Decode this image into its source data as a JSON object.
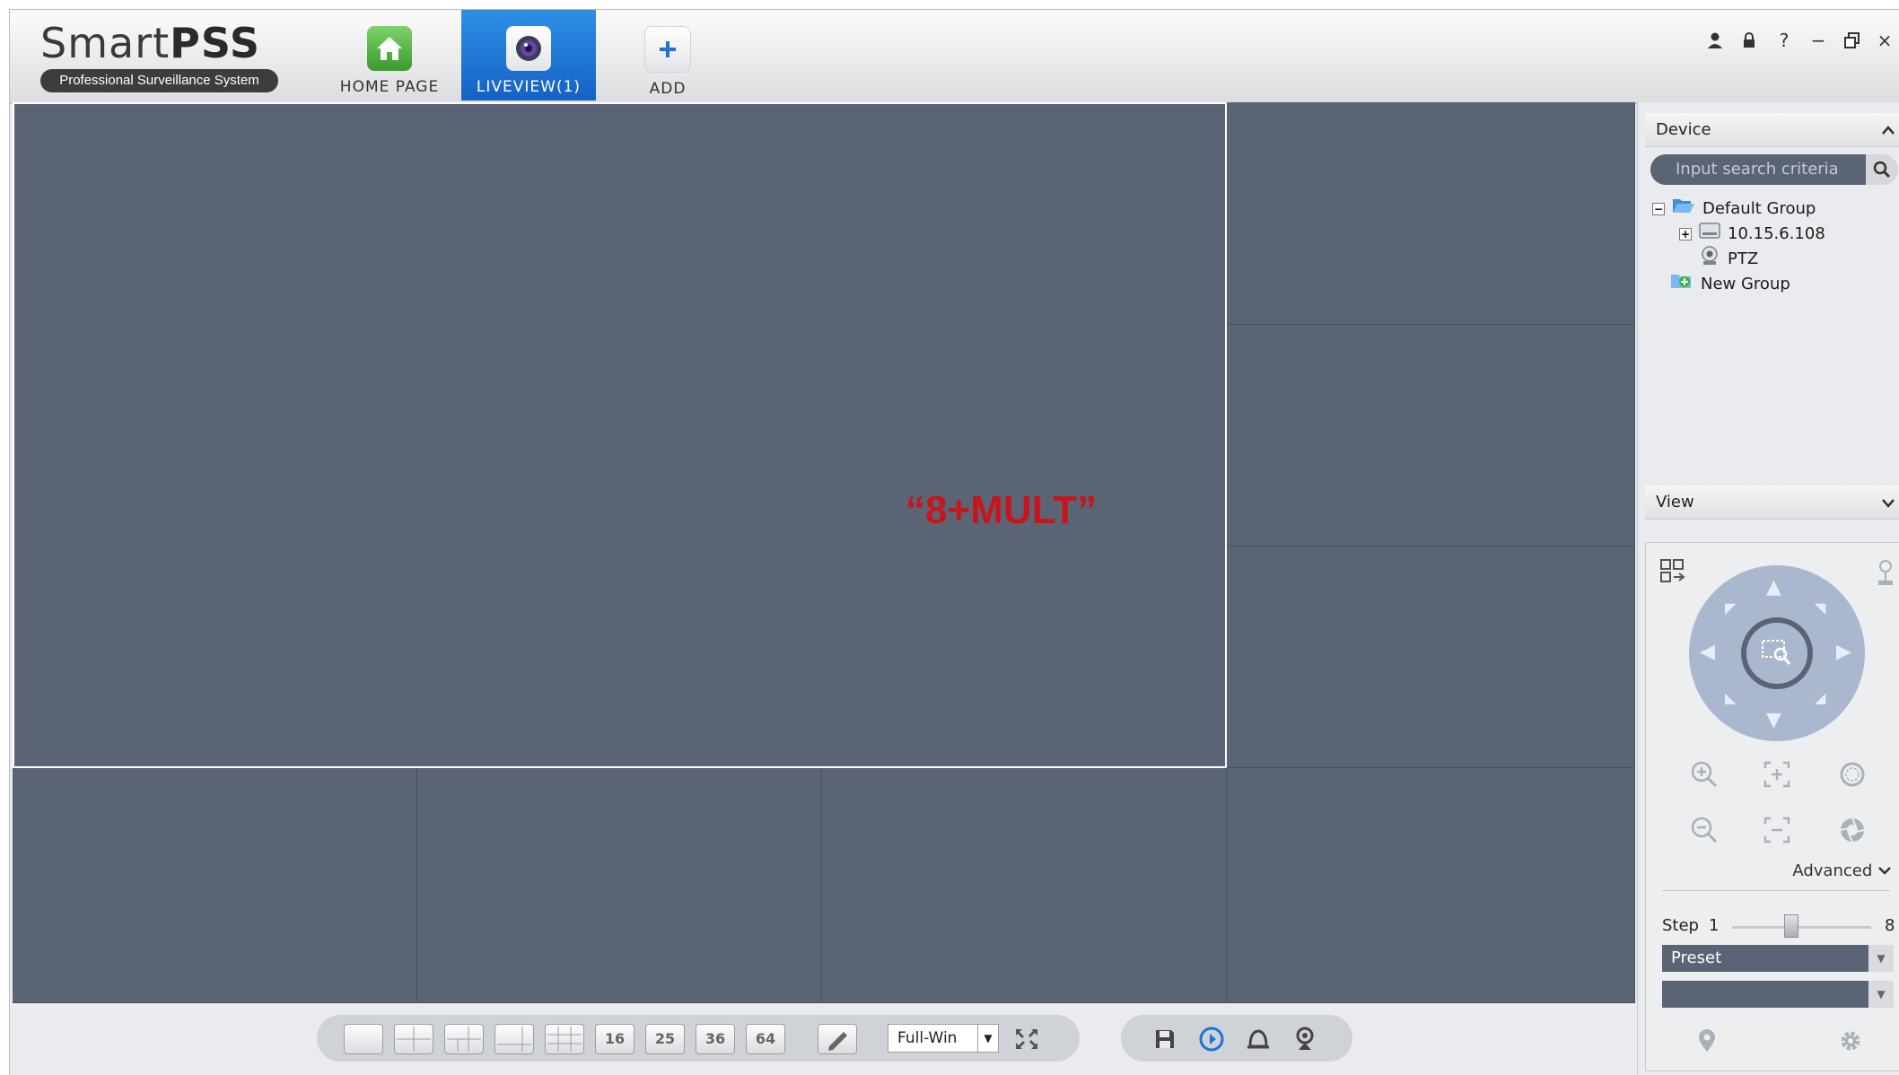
{
  "app": {
    "logo_main_light": "Smart",
    "logo_main_bold": "PSS",
    "logo_sub": "Professional Surveillance System"
  },
  "nav": {
    "tabs": [
      {
        "label": "HOME PAGE",
        "icon": "home-icon",
        "active": false
      },
      {
        "label": "LIVEVIEW(1)",
        "icon": "camera-lens-icon",
        "active": true
      },
      {
        "label": "ADD",
        "icon": "plus-icon",
        "active": false
      }
    ]
  },
  "window_controls": [
    "user-icon",
    "lock-icon",
    "help-icon",
    "minimize-icon",
    "restore-icon",
    "close-icon"
  ],
  "window_control_glyphs": [
    "?",
    "−",
    "×"
  ],
  "stage": {
    "annotation": "“8+MULT”",
    "layout_mode": "8+MULT"
  },
  "toolbar": {
    "layout_labels": [
      "16",
      "25",
      "36",
      "64"
    ],
    "full_win": "Full-Win"
  },
  "device_panel": {
    "title": "Device",
    "search_placeholder": "Input search criteria",
    "tree": [
      {
        "label": "Default Group",
        "expander": "−",
        "icon": "folder-open-icon"
      },
      {
        "label": "10.15.6.108",
        "expander": "+",
        "icon": "dvr-device-icon"
      },
      {
        "label": "PTZ",
        "icon": "ptz-camera-icon"
      },
      {
        "label": "New Group",
        "icon": "new-group-icon"
      }
    ]
  },
  "view_panel": {
    "title": "View"
  },
  "ptz": {
    "advanced": "Advanced",
    "step_label": "Step",
    "step_min": "1",
    "step_max": "8",
    "step_value": 4,
    "preset": "Preset",
    "second_dropdown": ""
  },
  "colors": {
    "stage_bg": "#5b6474",
    "active_tab": "#1d6fd4",
    "annotation": "#c8151d"
  }
}
